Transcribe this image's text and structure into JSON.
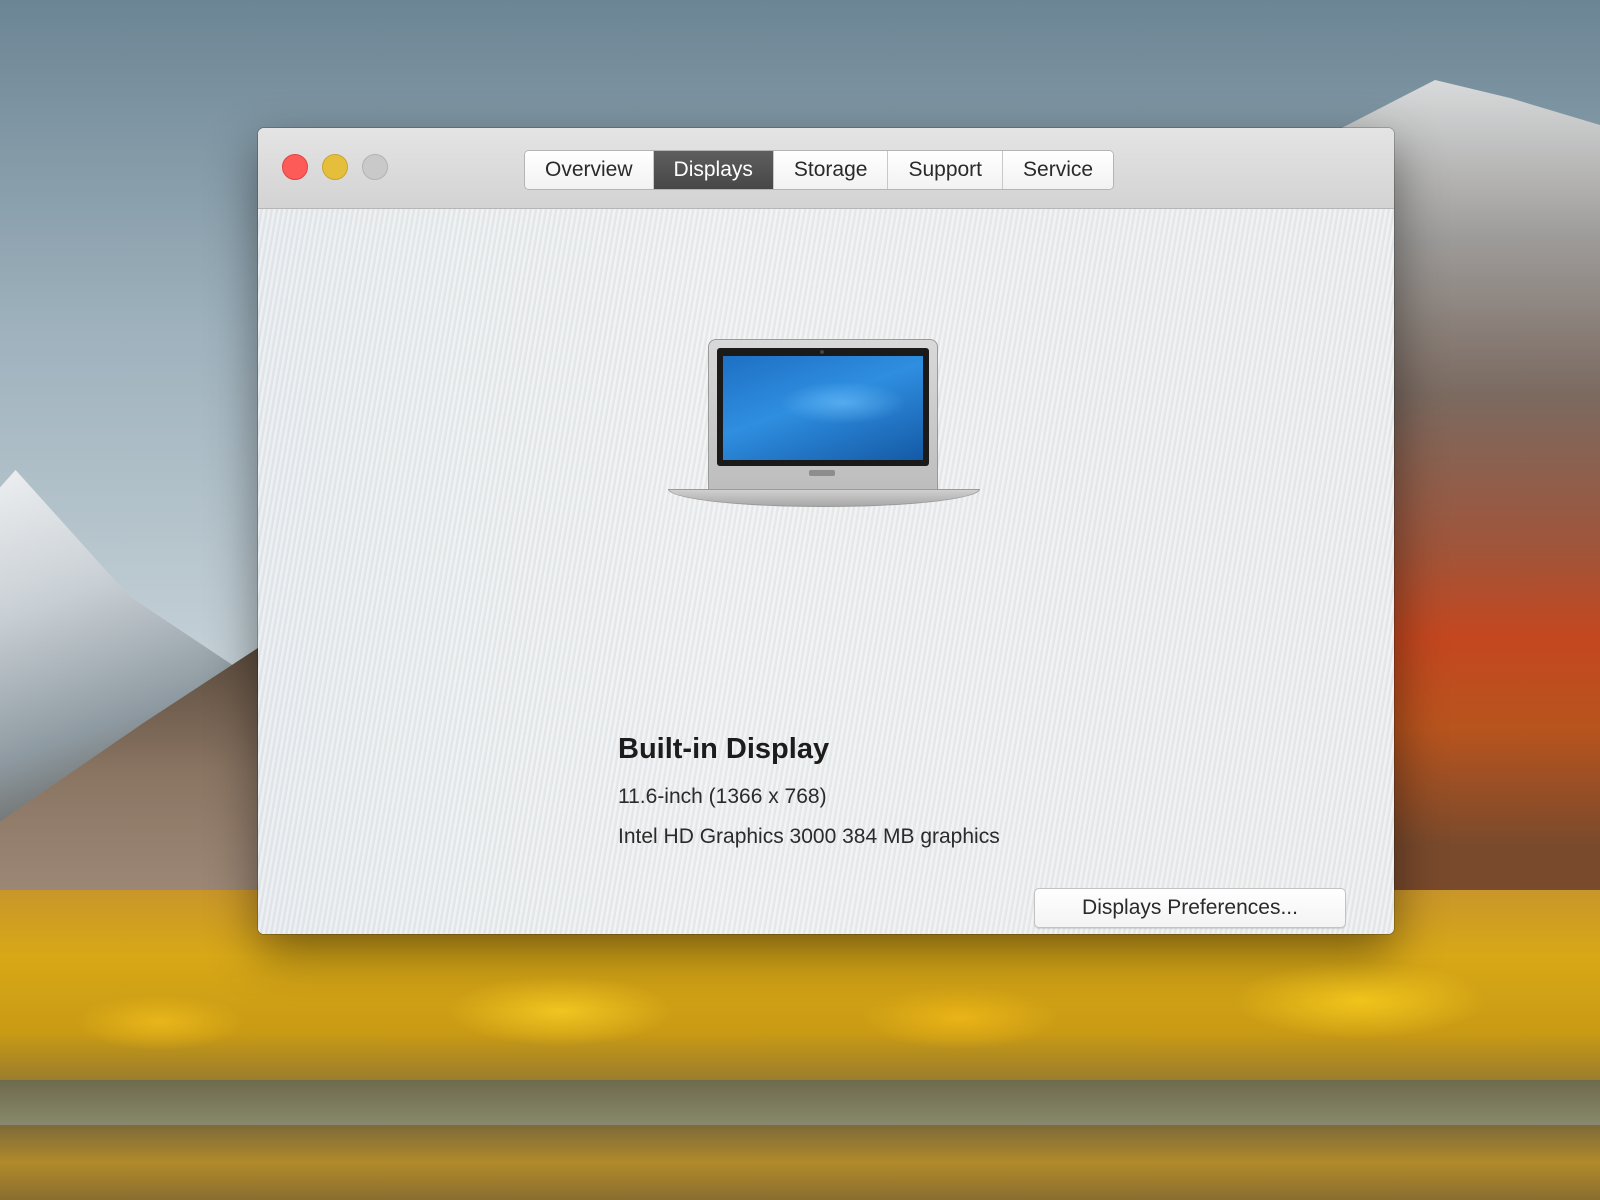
{
  "window": {
    "tabs": [
      {
        "label": "Overview",
        "active": false
      },
      {
        "label": "Displays",
        "active": true
      },
      {
        "label": "Storage",
        "active": false
      },
      {
        "label": "Support",
        "active": false
      },
      {
        "label": "Service",
        "active": false
      }
    ]
  },
  "display": {
    "name": "Built-in Display",
    "size_resolution": "11.6-inch (1366 x 768)",
    "graphics": "Intel HD Graphics 3000 384 MB graphics",
    "icon": "laptop-icon"
  },
  "actions": {
    "preferences_button": "Displays Preferences..."
  },
  "colors": {
    "close": "#fc5b57",
    "minimize": "#e5bf3c",
    "zoom": "#c9c9c9",
    "active_tab": "#4f4f4f"
  }
}
